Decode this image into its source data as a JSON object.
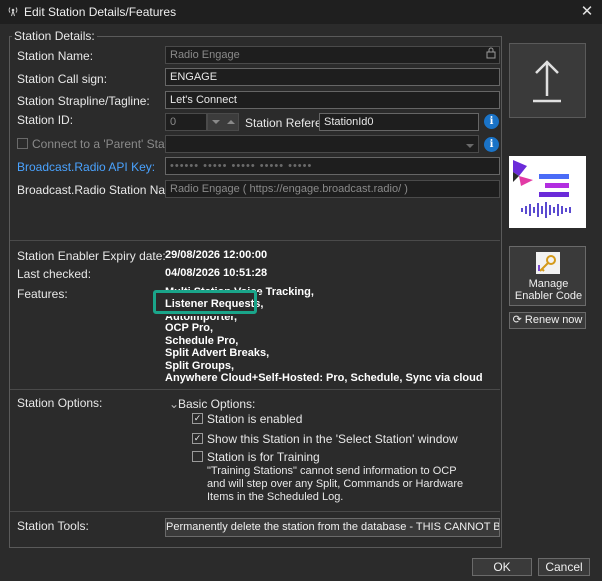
{
  "window": {
    "title": "Edit Station Details/Features",
    "close_glyph": "✕"
  },
  "station_details": {
    "legend": "Station Details:",
    "name_label": "Station Name:",
    "name_value": "Radio Engage",
    "call_sign_label": "Station Call sign:",
    "call_sign_value": "ENGAGE",
    "strapline_label": "Station Strapline/Tagline:",
    "strapline_value": "Let's Connect",
    "id_label": "Station ID:",
    "id_value": "0",
    "reference_label": "Station Reference:",
    "reference_value": "StationId0",
    "parent_label": "Connect to a 'Parent' Station:",
    "api_key_label": "Broadcast.Radio API Key:",
    "api_key_value": "•••••• ••••• ••••• ••••• •••••",
    "br_name_label": "Broadcast.Radio Station Name:",
    "br_name_value": "Radio Engage ( https://engage.broadcast.radio/ )",
    "expiry_label": "Station Enabler Expiry date:",
    "expiry_value": "29/08/2026 12:00:00",
    "last_checked_label": "Last checked:",
    "last_checked_value": "04/08/2026 10:51:28",
    "features_label": "Features:",
    "features": [
      "Multi Station Voice Tracking,",
      "Listener Requests,",
      "AutoImporter,",
      "OCP Pro,",
      "Schedule Pro,",
      "Split Advert Breaks,",
      "Split Groups,",
      "Anywhere Cloud+Self-Hosted: Pro, Schedule, Sync via cloud"
    ]
  },
  "side": {
    "upload_glyph": "↑",
    "manage_enabler_label": "Manage Enabler Code",
    "renew_label": "Renew now",
    "renew_glyph": "⟳"
  },
  "station_options": {
    "label": "Station Options:",
    "group_label": "Basic Options:",
    "enabled_label": "Station is enabled",
    "enabled_checked": true,
    "show_label": "Show this Station in the 'Select Station' window",
    "show_checked": true,
    "training_label": "Station is for Training",
    "training_checked": false,
    "training_note": "\"Training Stations\" cannot send information to OCP and will step over any Split, Commands or Hardware Items in the Scheduled Log."
  },
  "station_tools": {
    "label": "Station Tools:",
    "delete_button": "Permanently delete the station from the database - THIS CANNOT BE UNDONE"
  },
  "footer": {
    "ok": "OK",
    "cancel": "Cancel"
  },
  "colors": {
    "accent_blue": "#1a73c7",
    "highlight_green": "#1aa58a",
    "link_blue": "#4aa3ff",
    "logo_purple": "#6b2bd9",
    "logo_pink": "#e23aa5"
  }
}
